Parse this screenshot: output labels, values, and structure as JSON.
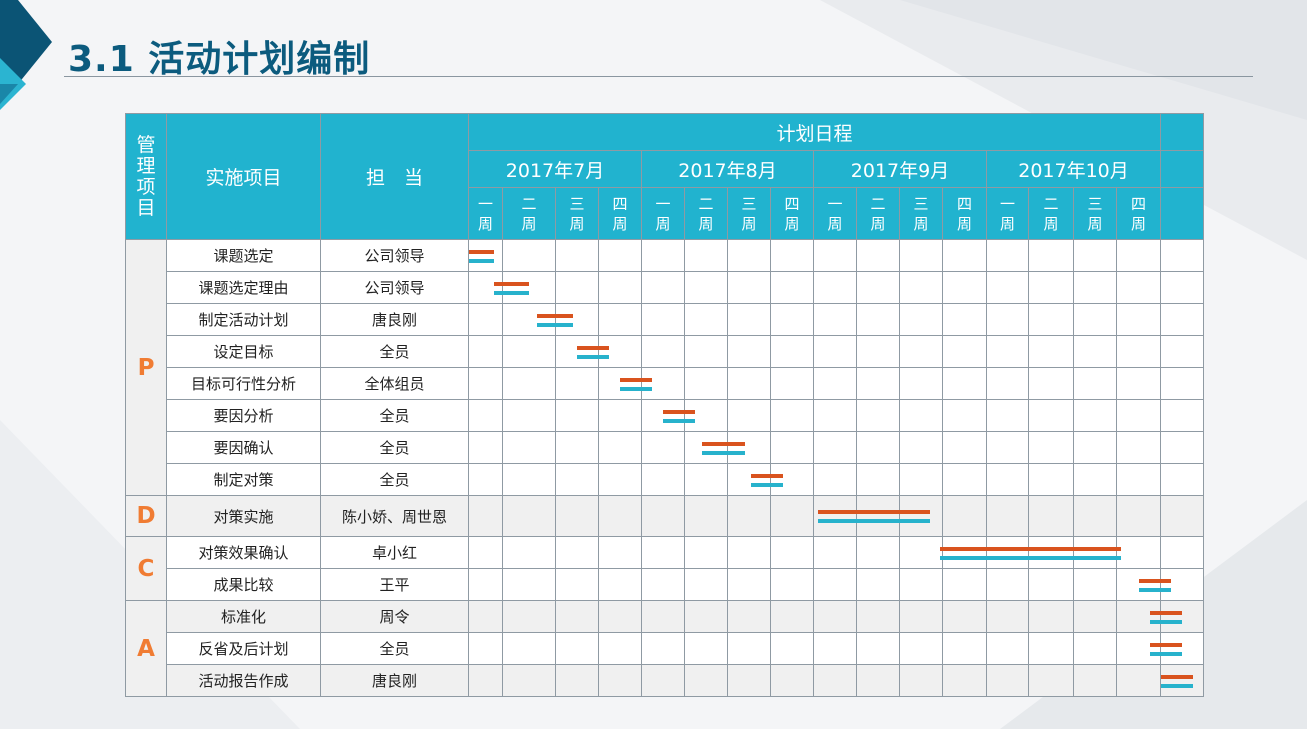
{
  "title": "3.1  活动计划编制",
  "colors": {
    "header": "#21b3cf",
    "plan_bar": "#d9531e",
    "actual_bar": "#27b2cc",
    "phase_letter": "#f07c33",
    "title": "#0c5b7e"
  },
  "header": {
    "phase_col": "管理项目",
    "item_col": "实施项目",
    "owner_col": "担　当",
    "schedule": "计划日程",
    "months": [
      "2017年7月",
      "2017年8月",
      "2017年9月",
      "2017年10月"
    ],
    "weeks": [
      {
        "top": "一",
        "bottom": "周"
      },
      {
        "top": "二",
        "bottom": "周"
      },
      {
        "top": "三",
        "bottom": "周"
      },
      {
        "top": "四",
        "bottom": "周"
      },
      {
        "top": "一",
        "bottom": "周"
      },
      {
        "top": "二",
        "bottom": "周"
      },
      {
        "top": "三",
        "bottom": "周"
      },
      {
        "top": "四",
        "bottom": "周"
      },
      {
        "top": "一",
        "bottom": "周"
      },
      {
        "top": "二",
        "bottom": "周"
      },
      {
        "top": "三",
        "bottom": "周"
      },
      {
        "top": "四",
        "bottom": "周"
      },
      {
        "top": "一",
        "bottom": "周"
      },
      {
        "top": "二",
        "bottom": "周"
      },
      {
        "top": "三",
        "bottom": "周"
      },
      {
        "top": "四",
        "bottom": "周"
      }
    ]
  },
  "phases": [
    "P",
    "D",
    "C",
    "A"
  ],
  "tasks": [
    {
      "phase": "P",
      "item": "课题选定",
      "owner": "公司领导",
      "plan": [
        0,
        0.75
      ],
      "actual": [
        0,
        0.75
      ]
    },
    {
      "phase": "P",
      "item": "课题选定理由",
      "owner": "公司领导",
      "plan": [
        0.75,
        1.5
      ],
      "actual": [
        0.75,
        1.5
      ]
    },
    {
      "phase": "P",
      "item": "制定活动计划",
      "owner": "唐良刚",
      "plan": [
        1.65,
        2.4
      ],
      "actual": [
        1.65,
        2.4
      ]
    },
    {
      "phase": "P",
      "item": "设定目标",
      "owner": "全员",
      "plan": [
        2.5,
        3.25
      ],
      "actual": [
        2.5,
        3.25
      ]
    },
    {
      "phase": "P",
      "item": "目标可行性分析",
      "owner": "全体组员",
      "plan": [
        3.5,
        4.25
      ],
      "actual": [
        3.5,
        4.25
      ]
    },
    {
      "phase": "P",
      "item": "要因分析",
      "owner": "全员",
      "plan": [
        4.5,
        5.25
      ],
      "actual": [
        4.5,
        5.25
      ]
    },
    {
      "phase": "P",
      "item": "要因确认",
      "owner": "全员",
      "plan": [
        5.4,
        6.4
      ],
      "actual": [
        5.4,
        6.4
      ]
    },
    {
      "phase": "P",
      "item": "制定对策",
      "owner": "全员",
      "plan": [
        6.55,
        7.3
      ],
      "actual": [
        6.55,
        7.3
      ]
    },
    {
      "phase": "D",
      "item": "对策实施",
      "owner": "陈小娇、周世恩",
      "plan": [
        8.1,
        10.7
      ],
      "actual": [
        8.1,
        10.7
      ]
    },
    {
      "phase": "C",
      "item": "对策效果确认",
      "owner": "卓小红",
      "plan": [
        10.95,
        15.1
      ],
      "actual": [
        10.95,
        15.1
      ]
    },
    {
      "phase": "C",
      "item": "成果比较",
      "owner": "王平",
      "plan": [
        15.5,
        16.25
      ],
      "actual": [
        15.5,
        16.25
      ]
    },
    {
      "phase": "A",
      "item": "标准化",
      "owner": "周令",
      "plan": [
        15.75,
        16.5
      ],
      "actual": [
        15.75,
        16.5
      ]
    },
    {
      "phase": "A",
      "item": "反省及后计划",
      "owner": "全员",
      "plan": [
        15.75,
        16.5
      ],
      "actual": [
        15.75,
        16.5
      ]
    },
    {
      "phase": "A",
      "item": "活动报告作成",
      "owner": "唐良刚",
      "plan": [
        16,
        16.75
      ],
      "actual": [
        16,
        16.75
      ]
    }
  ]
}
